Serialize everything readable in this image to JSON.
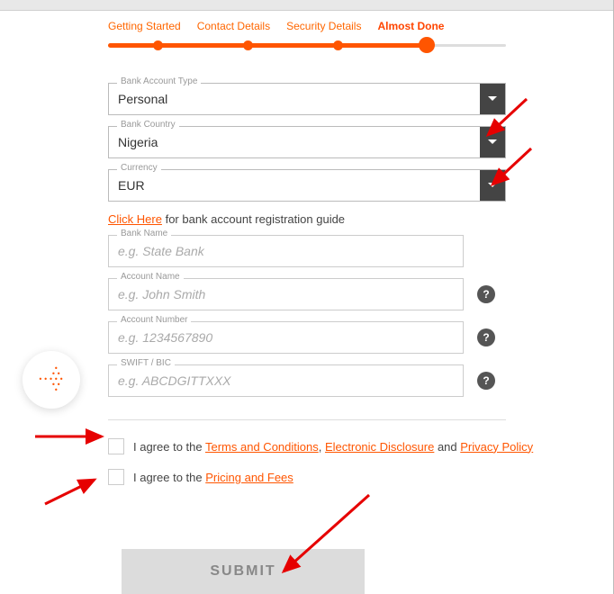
{
  "progress": {
    "steps": [
      "Getting Started",
      "Contact Details",
      "Security Details",
      "Almost Done"
    ],
    "active": 3
  },
  "fields": {
    "bank_account_type": {
      "legend": "Bank Account Type",
      "value": "Personal"
    },
    "bank_country": {
      "legend": "Bank Country",
      "value": "Nigeria"
    },
    "currency": {
      "legend": "Currency",
      "value": "EUR"
    },
    "bank_name": {
      "legend": "Bank Name",
      "placeholder": "e.g. State Bank"
    },
    "account_name": {
      "legend": "Account Name",
      "placeholder": "e.g. John Smith"
    },
    "account_number": {
      "legend": "Account Number",
      "placeholder": "e.g. 1234567890"
    },
    "swift_bic": {
      "legend": "SWIFT / BIC",
      "placeholder": "e.g. ABCDGITTXXX"
    }
  },
  "guide": {
    "link_text": "Click Here",
    "suffix": " for bank account registration guide"
  },
  "agreements": {
    "terms": {
      "prefix": "I agree to the ",
      "links": [
        "Terms and Conditions",
        "Electronic Disclosure",
        "Privacy Policy"
      ],
      "connectors": [
        ", ",
        " and "
      ]
    },
    "pricing": {
      "prefix": "I agree to the ",
      "link": "Pricing and Fees"
    }
  },
  "submit": {
    "label": "SUBMIT"
  }
}
